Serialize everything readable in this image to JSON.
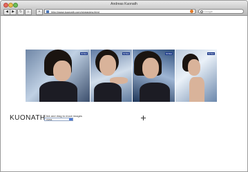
{
  "window": {
    "title": "Andreas Kuonath"
  },
  "toolbar": {
    "back_label": "◀",
    "forward_label": "▶",
    "reload_label": "↻",
    "home_label": "⌂",
    "add_label": "+",
    "address_url": "http://www.kuonath.com/niveaview.html",
    "search_placeholder": "Google"
  },
  "gallery": {
    "badge_text": "NIVEA",
    "images": [
      {
        "name": "portrait-1",
        "accent": "#1d3a8a"
      },
      {
        "name": "portrait-2",
        "accent": "#1d3a8a"
      },
      {
        "name": "portrait-3",
        "accent": "#1d3a8a"
      },
      {
        "name": "portrait-4",
        "accent": "#1d3a8a"
      }
    ]
  },
  "footer": {
    "logo": "KUONATH",
    "hint": "Click and drag to move images",
    "select_value": "nivea"
  }
}
